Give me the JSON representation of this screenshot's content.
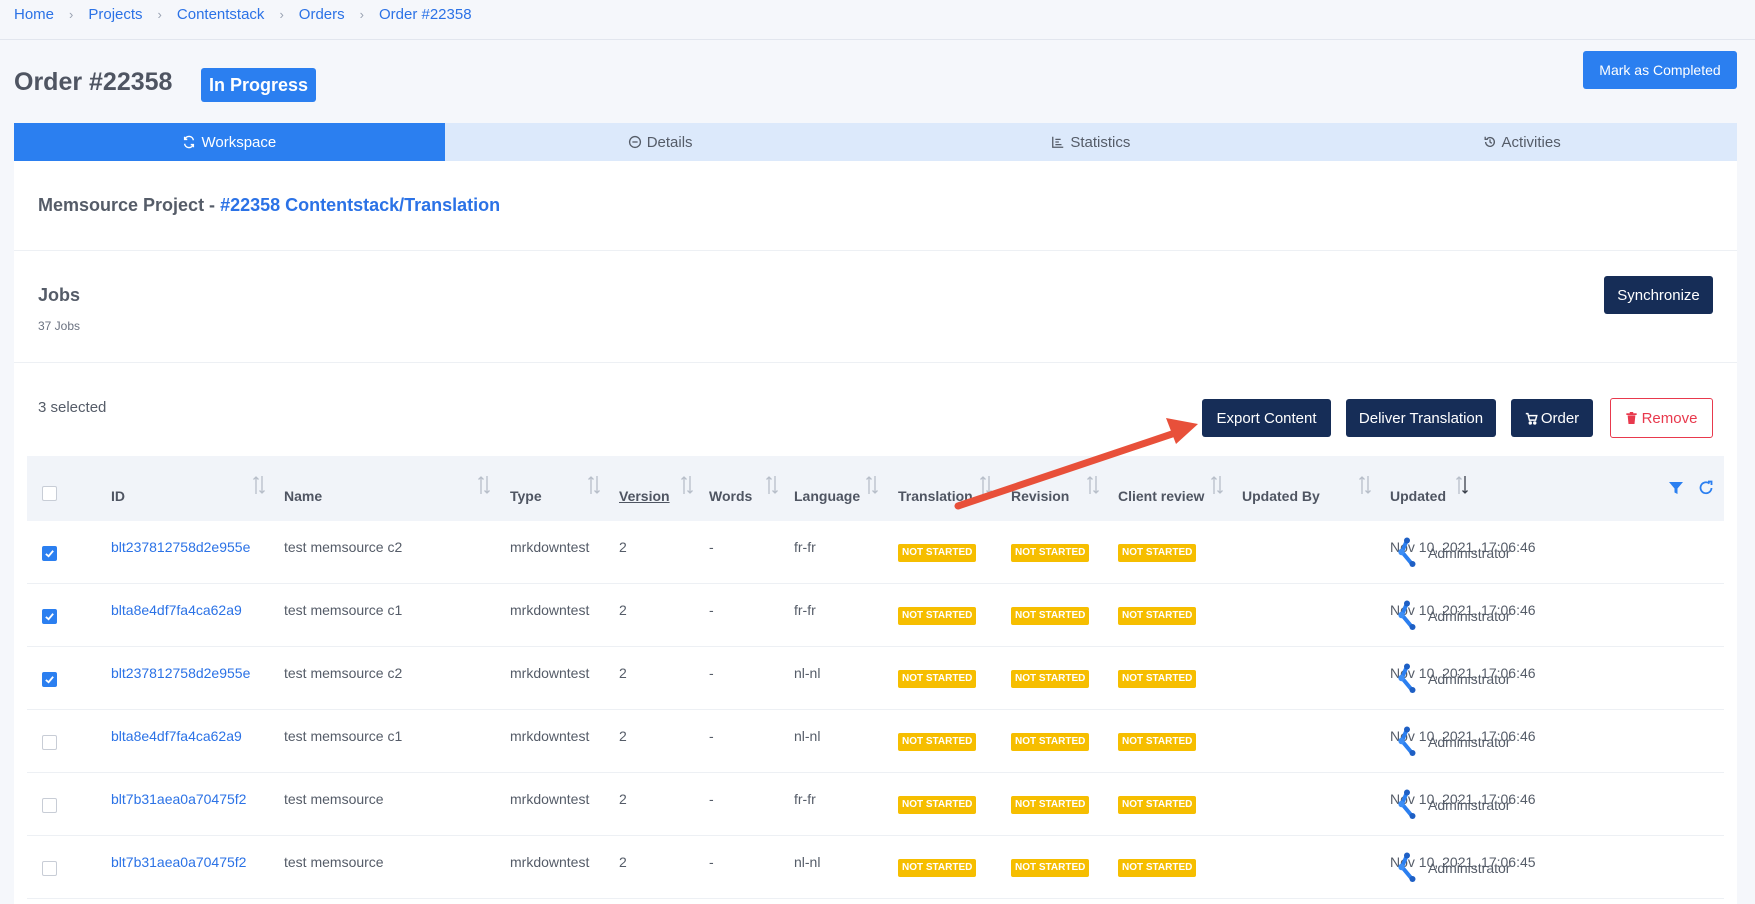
{
  "breadcrumb": [
    "Home",
    "Projects",
    "Contentstack",
    "Orders",
    "Order #22358"
  ],
  "order": {
    "title": "Order #22358",
    "status": "In Progress"
  },
  "header": {
    "mark_completed_label": "Mark as Completed"
  },
  "tabs": [
    {
      "label": "Workspace",
      "icon": "workspace-icon",
      "active": true
    },
    {
      "label": "Details",
      "icon": "details-icon",
      "active": false
    },
    {
      "label": "Statistics",
      "icon": "statistics-icon",
      "active": false
    },
    {
      "label": "Activities",
      "icon": "activities-icon",
      "active": false
    }
  ],
  "project": {
    "prefix": "Memsource Project - ",
    "link": "#22358 Contentstack/Translation"
  },
  "jobs": {
    "title": "Jobs",
    "count": "37 Jobs",
    "sync_label": "Synchronize"
  },
  "selection": {
    "text": "3 selected"
  },
  "actions": {
    "export": "Export Content",
    "deliver": "Deliver Translation",
    "order": "Order",
    "remove": "Remove"
  },
  "table": {
    "headers": [
      "ID",
      "Name",
      "Type",
      "Version",
      "Words",
      "Language",
      "Translation",
      "Revision",
      "Client review",
      "Updated By",
      "Updated"
    ],
    "rows": [
      {
        "checked": true,
        "id": "blt237812758d2e955e",
        "name": "test memsource c2",
        "type": "mrkdowntest",
        "version": "2",
        "words": "-",
        "language": "fr-fr",
        "translation": "NOT STARTED",
        "revision": "NOT STARTED",
        "client_review": "NOT STARTED",
        "updated_by": "Administrator",
        "updated": "Nov 10, 2021, 17:06:46"
      },
      {
        "checked": true,
        "id": "blta8e4df7fa4ca62a9",
        "name": "test memsource c1",
        "type": "mrkdowntest",
        "version": "2",
        "words": "-",
        "language": "fr-fr",
        "translation": "NOT STARTED",
        "revision": "NOT STARTED",
        "client_review": "NOT STARTED",
        "updated_by": "Administrator",
        "updated": "Nov 10, 2021, 17:06:46"
      },
      {
        "checked": true,
        "id": "blt237812758d2e955e",
        "name": "test memsource c2",
        "type": "mrkdowntest",
        "version": "2",
        "words": "-",
        "language": "nl-nl",
        "translation": "NOT STARTED",
        "revision": "NOT STARTED",
        "client_review": "NOT STARTED",
        "updated_by": "Administrator",
        "updated": "Nov 10, 2021, 17:06:46"
      },
      {
        "checked": false,
        "id": "blta8e4df7fa4ca62a9",
        "name": "test memsource c1",
        "type": "mrkdowntest",
        "version": "2",
        "words": "-",
        "language": "nl-nl",
        "translation": "NOT STARTED",
        "revision": "NOT STARTED",
        "client_review": "NOT STARTED",
        "updated_by": "Administrator",
        "updated": "Nov 10, 2021, 17:06:46"
      },
      {
        "checked": false,
        "id": "blt7b31aea0a70475f2",
        "name": "test memsource",
        "type": "mrkdowntest",
        "version": "2",
        "words": "-",
        "language": "fr-fr",
        "translation": "NOT STARTED",
        "revision": "NOT STARTED",
        "client_review": "NOT STARTED",
        "updated_by": "Administrator",
        "updated": "Nov 10, 2021, 17:06:46"
      },
      {
        "checked": false,
        "id": "blt7b31aea0a70475f2",
        "name": "test memsource",
        "type": "mrkdowntest",
        "version": "2",
        "words": "-",
        "language": "nl-nl",
        "translation": "NOT STARTED",
        "revision": "NOT STARTED",
        "client_review": "NOT STARTED",
        "updated_by": "Administrator",
        "updated": "Nov 10, 2021, 17:06:45"
      }
    ]
  },
  "colors": {
    "primary": "#2b7ff0",
    "navy": "#162d57",
    "danger": "#e8394d",
    "warning": "#f6be00",
    "annotation": "#e8503a"
  }
}
